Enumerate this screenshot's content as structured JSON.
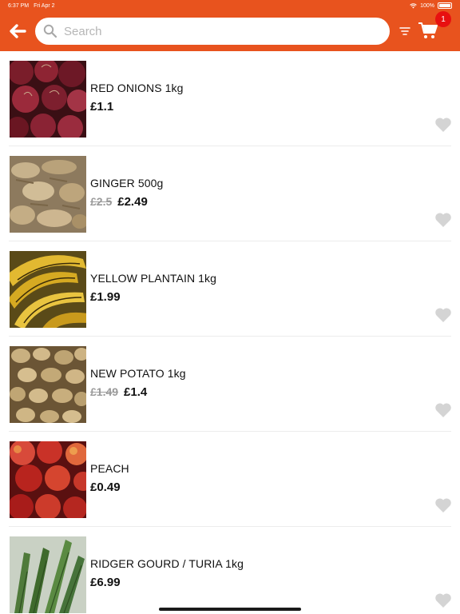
{
  "status_bar": {
    "time": "6:37 PM",
    "date": "Fri Apr 2",
    "battery": "100%"
  },
  "header": {
    "search_placeholder": "Search",
    "cart_count": "1",
    "accent_color": "#e8531e",
    "badge_color": "#e81010"
  },
  "products": [
    {
      "name": "RED ONIONS 1kg",
      "old_price": "",
      "price": "£1.1",
      "image": "red-onions"
    },
    {
      "name": "GINGER 500g",
      "old_price": "£2.5",
      "price": "£2.49",
      "image": "ginger"
    },
    {
      "name": "YELLOW PLANTAIN 1kg",
      "old_price": "",
      "price": "£1.99",
      "image": "plantain"
    },
    {
      "name": "NEW POTATO 1kg",
      "old_price": "£1.49",
      "price": "£1.4",
      "image": "potatoes"
    },
    {
      "name": "PEACH",
      "old_price": "",
      "price": "£0.49",
      "image": "peach"
    },
    {
      "name": "RIDGER GOURD / TURIA 1kg",
      "old_price": "",
      "price": "£6.99",
      "image": "ridge-gourd"
    }
  ]
}
